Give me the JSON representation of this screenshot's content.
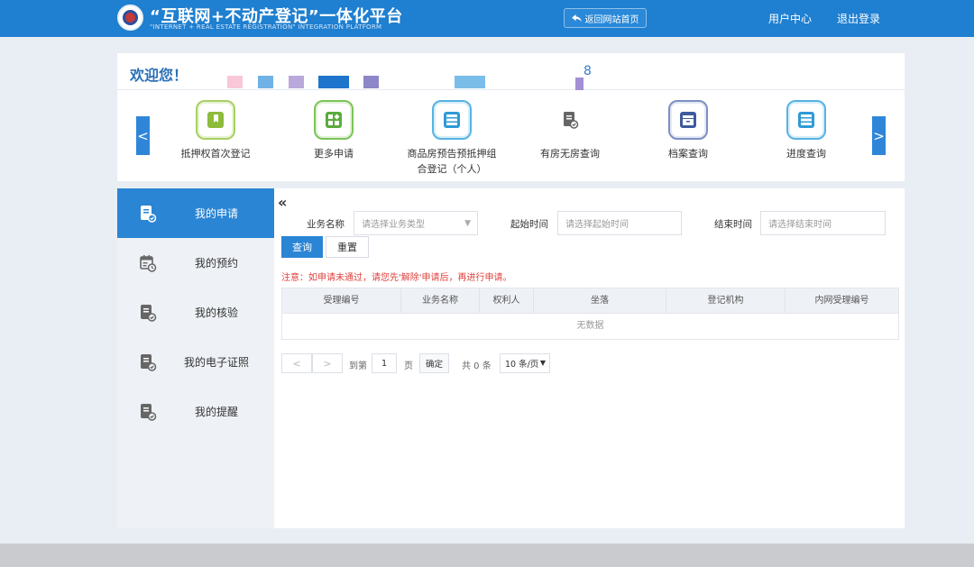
{
  "header": {
    "title_cn": "“互联网+不动产登记”一体化平台",
    "title_en": "\"INTERNET + REAL ESTATE REGISTRATION\" INTEGRATION PLATFORM",
    "home_button": "返回网站首页",
    "user_center": "用户中心",
    "logout": "退出登录"
  },
  "welcome": {
    "text": "欢迎您！",
    "number": "8"
  },
  "shortcuts": [
    {
      "label": "抵押权首次登记",
      "icon": "bookmark-icon",
      "color": "#8dbb3a"
    },
    {
      "label": "更多申请",
      "icon": "apps-icon",
      "color": "#5aab3c"
    },
    {
      "label": "商品房预告预抵押组合登记（个人）",
      "icon": "server-icon",
      "color": "#2e9ad6"
    },
    {
      "label": "有房无房查询",
      "icon": "document-check-icon",
      "color": "#666666"
    },
    {
      "label": "档案查询",
      "icon": "archive-icon",
      "color": "#3d5a9e"
    },
    {
      "label": "进度查询",
      "icon": "server-icon",
      "color": "#2e9ad6"
    }
  ],
  "sidebar": {
    "items": [
      {
        "label": "我的申请",
        "icon": "document-check-icon",
        "active": true
      },
      {
        "label": "我的预约",
        "icon": "calendar-clock-icon",
        "active": false
      },
      {
        "label": "我的核验",
        "icon": "document-check-icon",
        "active": false
      },
      {
        "label": "我的电子证照",
        "icon": "document-check-icon",
        "active": false
      },
      {
        "label": "我的提醒",
        "icon": "document-check-icon",
        "active": false
      }
    ]
  },
  "filters": {
    "business_label": "业务名称",
    "business_placeholder": "请选择业务类型",
    "start_label": "起始时间",
    "start_placeholder": "请选择起始时间",
    "end_label": "结束时间",
    "end_placeholder": "请选择结束时间",
    "query_button": "查询",
    "reset_button": "重置"
  },
  "notice": "注意：如申请未通过，请您先'解除'申请后，再进行申请。",
  "table": {
    "columns": [
      "受理编号",
      "业务名称",
      "权利人",
      "坐落",
      "登记机构",
      "内网受理编号"
    ],
    "empty_text": "无数据"
  },
  "pagination": {
    "goto_label": "到第",
    "page_value": "1",
    "page_unit": "页",
    "confirm": "确定",
    "total": "共 0 条",
    "page_size": "10 条/页"
  },
  "colors": {
    "primary": "#1f7fd0",
    "active": "#2a85d4",
    "notice": "#e0423d"
  }
}
